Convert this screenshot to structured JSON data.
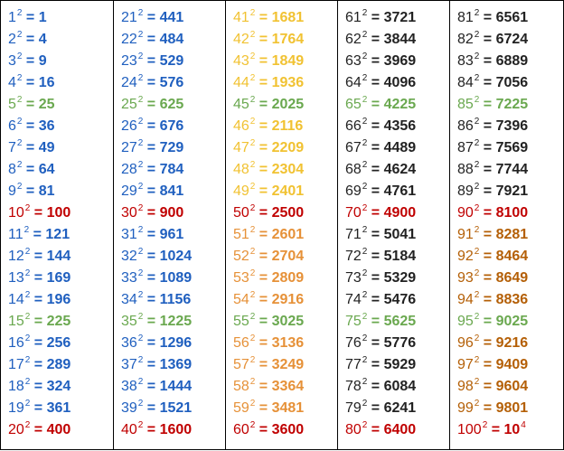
{
  "colors": {
    "blue": "#1f5fbf",
    "green": "#6aa84f",
    "red": "#c00000",
    "yellow": "#f1c232",
    "orange": "#e69138",
    "black": "#222222",
    "brown": "#b45f06"
  },
  "columns": [
    {
      "rows": [
        {
          "base": "1",
          "exp": "2",
          "res": "1",
          "color": "blue"
        },
        {
          "base": "2",
          "exp": "2",
          "res": "4",
          "color": "blue"
        },
        {
          "base": "3",
          "exp": "2",
          "res": "9",
          "color": "blue"
        },
        {
          "base": "4",
          "exp": "2",
          "res": "16",
          "color": "blue"
        },
        {
          "base": "5",
          "exp": "2",
          "res": "25",
          "color": "green"
        },
        {
          "base": "6",
          "exp": "2",
          "res": "36",
          "color": "blue"
        },
        {
          "base": "7",
          "exp": "2",
          "res": "49",
          "color": "blue"
        },
        {
          "base": "8",
          "exp": "2",
          "res": "64",
          "color": "blue"
        },
        {
          "base": "9",
          "exp": "2",
          "res": "81",
          "color": "blue"
        },
        {
          "base": "10",
          "exp": "2",
          "res": "100",
          "color": "red"
        },
        {
          "base": "11",
          "exp": "2",
          "res": "121",
          "color": "blue"
        },
        {
          "base": "12",
          "exp": "2",
          "res": "144",
          "color": "blue"
        },
        {
          "base": "13",
          "exp": "2",
          "res": "169",
          "color": "blue"
        },
        {
          "base": "14",
          "exp": "2",
          "res": "196",
          "color": "blue"
        },
        {
          "base": "15",
          "exp": "2",
          "res": "225",
          "color": "green"
        },
        {
          "base": "16",
          "exp": "2",
          "res": "256",
          "color": "blue"
        },
        {
          "base": "17",
          "exp": "2",
          "res": "289",
          "color": "blue"
        },
        {
          "base": "18",
          "exp": "2",
          "res": "324",
          "color": "blue"
        },
        {
          "base": "19",
          "exp": "2",
          "res": "361",
          "color": "blue"
        },
        {
          "base": "20",
          "exp": "2",
          "res": "400",
          "color": "red"
        }
      ]
    },
    {
      "rows": [
        {
          "base": "21",
          "exp": "2",
          "res": "441",
          "color": "blue"
        },
        {
          "base": "22",
          "exp": "2",
          "res": "484",
          "color": "blue"
        },
        {
          "base": "23",
          "exp": "2",
          "res": "529",
          "color": "blue"
        },
        {
          "base": "24",
          "exp": "2",
          "res": "576",
          "color": "blue"
        },
        {
          "base": "25",
          "exp": "2",
          "res": "625",
          "color": "green"
        },
        {
          "base": "26",
          "exp": "2",
          "res": "676",
          "color": "blue"
        },
        {
          "base": "27",
          "exp": "2",
          "res": "729",
          "color": "blue"
        },
        {
          "base": "28",
          "exp": "2",
          "res": "784",
          "color": "blue"
        },
        {
          "base": "29",
          "exp": "2",
          "res": "841",
          "color": "blue"
        },
        {
          "base": "30",
          "exp": "2",
          "res": "900",
          "color": "red"
        },
        {
          "base": "31",
          "exp": "2",
          "res": "961",
          "color": "blue"
        },
        {
          "base": "32",
          "exp": "2",
          "res": "1024",
          "color": "blue"
        },
        {
          "base": "33",
          "exp": "2",
          "res": "1089",
          "color": "blue"
        },
        {
          "base": "34",
          "exp": "2",
          "res": "1156",
          "color": "blue"
        },
        {
          "base": "35",
          "exp": "2",
          "res": "1225",
          "color": "green"
        },
        {
          "base": "36",
          "exp": "2",
          "res": "1296",
          "color": "blue"
        },
        {
          "base": "37",
          "exp": "2",
          "res": "1369",
          "color": "blue"
        },
        {
          "base": "38",
          "exp": "2",
          "res": "1444",
          "color": "blue"
        },
        {
          "base": "39",
          "exp": "2",
          "res": "1521",
          "color": "blue"
        },
        {
          "base": "40",
          "exp": "2",
          "res": "1600",
          "color": "red"
        }
      ]
    },
    {
      "rows": [
        {
          "base": "41",
          "exp": "2",
          "res": "1681",
          "color": "yellow"
        },
        {
          "base": "42",
          "exp": "2",
          "res": "1764",
          "color": "yellow"
        },
        {
          "base": "43",
          "exp": "2",
          "res": "1849",
          "color": "yellow"
        },
        {
          "base": "44",
          "exp": "2",
          "res": "1936",
          "color": "yellow"
        },
        {
          "base": "45",
          "exp": "2",
          "res": "2025",
          "color": "green"
        },
        {
          "base": "46",
          "exp": "2",
          "res": "2116",
          "color": "yellow"
        },
        {
          "base": "47",
          "exp": "2",
          "res": "2209",
          "color": "yellow"
        },
        {
          "base": "48",
          "exp": "2",
          "res": "2304",
          "color": "yellow"
        },
        {
          "base": "49",
          "exp": "2",
          "res": "2401",
          "color": "yellow"
        },
        {
          "base": "50",
          "exp": "2",
          "res": "2500",
          "color": "red"
        },
        {
          "base": "51",
          "exp": "2",
          "res": "2601",
          "color": "orange"
        },
        {
          "base": "52",
          "exp": "2",
          "res": "2704",
          "color": "orange"
        },
        {
          "base": "53",
          "exp": "2",
          "res": "2809",
          "color": "orange"
        },
        {
          "base": "54",
          "exp": "2",
          "res": "2916",
          "color": "orange"
        },
        {
          "base": "55",
          "exp": "2",
          "res": "3025",
          "color": "green"
        },
        {
          "base": "56",
          "exp": "2",
          "res": "3136",
          "color": "orange"
        },
        {
          "base": "57",
          "exp": "2",
          "res": "3249",
          "color": "orange"
        },
        {
          "base": "58",
          "exp": "2",
          "res": "3364",
          "color": "orange"
        },
        {
          "base": "59",
          "exp": "2",
          "res": "3481",
          "color": "orange"
        },
        {
          "base": "60",
          "exp": "2",
          "res": "3600",
          "color": "red"
        }
      ]
    },
    {
      "rows": [
        {
          "base": "61",
          "exp": "2",
          "res": "3721",
          "color": "black"
        },
        {
          "base": "62",
          "exp": "2",
          "res": "3844",
          "color": "black"
        },
        {
          "base": "63",
          "exp": "2",
          "res": "3969",
          "color": "black"
        },
        {
          "base": "64",
          "exp": "2",
          "res": "4096",
          "color": "black"
        },
        {
          "base": "65",
          "exp": "2",
          "res": "4225",
          "color": "green"
        },
        {
          "base": "66",
          "exp": "2",
          "res": "4356",
          "color": "black"
        },
        {
          "base": "67",
          "exp": "2",
          "res": "4489",
          "color": "black"
        },
        {
          "base": "68",
          "exp": "2",
          "res": "4624",
          "color": "black"
        },
        {
          "base": "69",
          "exp": "2",
          "res": "4761",
          "color": "black"
        },
        {
          "base": "70",
          "exp": "2",
          "res": "4900",
          "color": "red"
        },
        {
          "base": "71",
          "exp": "2",
          "res": "5041",
          "color": "black"
        },
        {
          "base": "72",
          "exp": "2",
          "res": "5184",
          "color": "black"
        },
        {
          "base": "73",
          "exp": "2",
          "res": "5329",
          "color": "black"
        },
        {
          "base": "74",
          "exp": "2",
          "res": "5476",
          "color": "black"
        },
        {
          "base": "75",
          "exp": "2",
          "res": "5625",
          "color": "green"
        },
        {
          "base": "76",
          "exp": "2",
          "res": "5776",
          "color": "black"
        },
        {
          "base": "77",
          "exp": "2",
          "res": "5929",
          "color": "black"
        },
        {
          "base": "78",
          "exp": "2",
          "res": "6084",
          "color": "black"
        },
        {
          "base": "79",
          "exp": "2",
          "res": "6241",
          "color": "black"
        },
        {
          "base": "80",
          "exp": "2",
          "res": "6400",
          "color": "red"
        }
      ]
    },
    {
      "rows": [
        {
          "base": "81",
          "exp": "2",
          "res": "6561",
          "color": "black"
        },
        {
          "base": "82",
          "exp": "2",
          "res": "6724",
          "color": "black"
        },
        {
          "base": "83",
          "exp": "2",
          "res": "6889",
          "color": "black"
        },
        {
          "base": "84",
          "exp": "2",
          "res": "7056",
          "color": "black"
        },
        {
          "base": "85",
          "exp": "2",
          "res": "7225",
          "color": "green"
        },
        {
          "base": "86",
          "exp": "2",
          "res": "7396",
          "color": "black"
        },
        {
          "base": "87",
          "exp": "2",
          "res": "7569",
          "color": "black"
        },
        {
          "base": "88",
          "exp": "2",
          "res": "7744",
          "color": "black"
        },
        {
          "base": "89",
          "exp": "2",
          "res": "7921",
          "color": "black"
        },
        {
          "base": "90",
          "exp": "2",
          "res": "8100",
          "color": "red"
        },
        {
          "base": "91",
          "exp": "2",
          "res": "8281",
          "color": "brown"
        },
        {
          "base": "92",
          "exp": "2",
          "res": "8464",
          "color": "brown"
        },
        {
          "base": "93",
          "exp": "2",
          "res": "8649",
          "color": "brown"
        },
        {
          "base": "94",
          "exp": "2",
          "res": "8836",
          "color": "brown"
        },
        {
          "base": "95",
          "exp": "2",
          "res": "9025",
          "color": "green"
        },
        {
          "base": "96",
          "exp": "2",
          "res": "9216",
          "color": "brown"
        },
        {
          "base": "97",
          "exp": "2",
          "res": "9409",
          "color": "brown"
        },
        {
          "base": "98",
          "exp": "2",
          "res": "9604",
          "color": "brown"
        },
        {
          "base": "99",
          "exp": "2",
          "res": "9801",
          "color": "brown"
        },
        {
          "base": "100",
          "exp": "2",
          "res": "10",
          "res_exp": "4",
          "color": "red"
        }
      ]
    }
  ]
}
